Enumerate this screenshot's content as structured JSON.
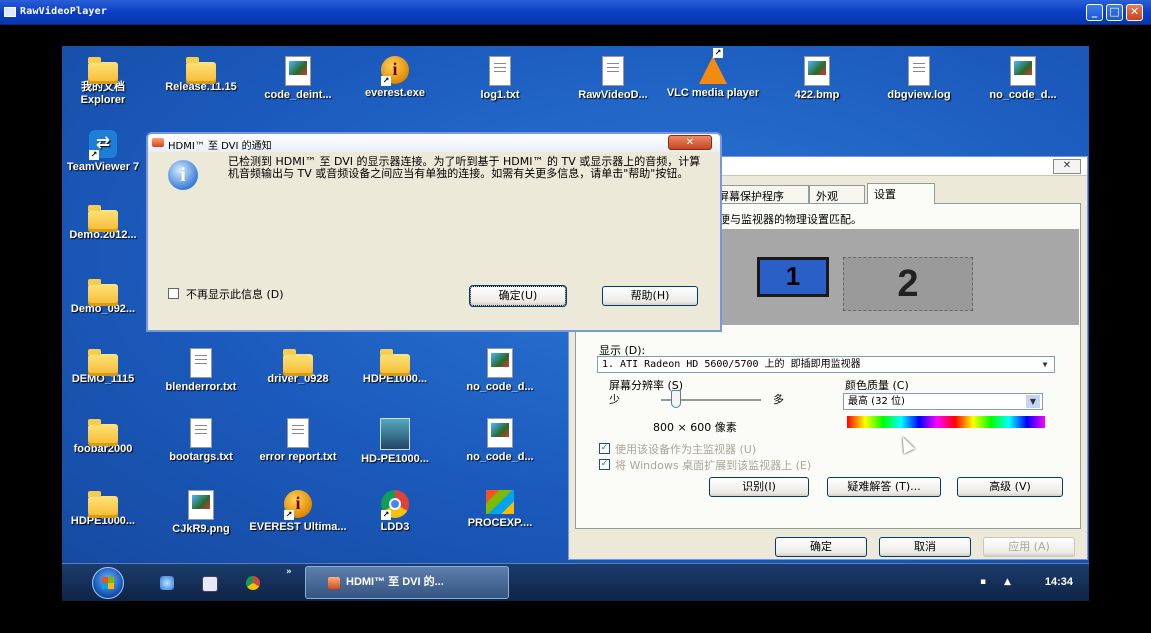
{
  "window": {
    "title": "RawVideoPlayer",
    "min": "_",
    "max": "□",
    "close": "✕"
  },
  "desktop_icons": [
    {
      "label": "我的文档\nExplorer",
      "icon": "folder-doc-icon",
      "x": 0,
      "y": 10
    },
    {
      "label": "Release.11.15",
      "icon": "folder-icon",
      "x": 1,
      "y": 10
    },
    {
      "label": "code_deint...",
      "icon": "image-file-icon",
      "x": 2,
      "y": 10
    },
    {
      "label": "everest.exe",
      "icon": "everest-icon",
      "x": 3,
      "y": 10
    },
    {
      "label": "log1.txt",
      "icon": "text-file-icon",
      "x": 4,
      "y": 10
    },
    {
      "label": "RawVideoD...",
      "icon": "text-file-icon",
      "x": 5,
      "y": 10
    },
    {
      "label": "VLC media player",
      "icon": "vlc-icon",
      "x": 6,
      "y": 10
    },
    {
      "label": "422.bmp",
      "icon": "image-file-icon",
      "x": 7,
      "y": 10
    },
    {
      "label": "dbgview.log",
      "icon": "text-file-icon",
      "x": 8,
      "y": 10
    },
    {
      "label": "no_code_d...",
      "icon": "image-file-icon",
      "x": 9,
      "y": 10
    }
  ],
  "col0_icons": [
    {
      "label": "TeamViewer 7",
      "icon": "teamviewer-icon"
    },
    {
      "label": "Demo.2012...",
      "icon": "folder-icon"
    },
    {
      "label": "Demo_092...",
      "icon": "folder-icon"
    }
  ],
  "row4_icons": [
    {
      "label": "DEMO_1115",
      "icon": "folder-icon"
    },
    {
      "label": "blenderror.txt",
      "icon": "text-file-icon"
    },
    {
      "label": "driver_0928",
      "icon": "folder-icon"
    },
    {
      "label": "HDPE1000...",
      "icon": "folder-icon"
    },
    {
      "label": "no_code_d...",
      "icon": "image-file-icon"
    }
  ],
  "row5_icons": [
    {
      "label": "foobar2000",
      "icon": "folder-icon"
    },
    {
      "label": "bootargs.txt",
      "icon": "text-file-icon"
    },
    {
      "label": "error report.txt",
      "icon": "text-file-icon"
    },
    {
      "label": "HD-PE1000...",
      "icon": "setup-icon"
    },
    {
      "label": "no_code_d...",
      "icon": "image-file-icon"
    }
  ],
  "row6_icons": [
    {
      "label": "HDPE1000...",
      "icon": "folder-icon"
    },
    {
      "label": "CJkR9.png",
      "icon": "image-file-icon"
    },
    {
      "label": "EVEREST Ultima...",
      "icon": "everest-icon"
    },
    {
      "label": "LDD3",
      "icon": "chrome-icon"
    },
    {
      "label": "PROCEXP....",
      "icon": "procexp-icon"
    }
  ],
  "display_dialog": {
    "close": "✕",
    "tabs": [
      "屏幕保护程序",
      "外观",
      "设置"
    ],
    "hint": "便与监视器的物理设置匹配。",
    "monitor1": "1",
    "monitor2": "2",
    "display_label": "显示 (D):",
    "display_value": "1. ATI Radeon HD 5600/5700 上的 即插即用监视器",
    "resolution_label": "屏幕分辨率 (S)",
    "less": "少",
    "more": "多",
    "resolution_value": "800 × 600 像素",
    "color_label": "颜色质量 (C)",
    "color_value": "最高 (32 位)",
    "chk_primary": "使用该设备作为主监视器 (U)",
    "chk_extend": "将 Windows 桌面扩展到该监视器上 (E)",
    "btn_identify": "识别(I)",
    "btn_troubleshoot": "疑难解答 (T)...",
    "btn_advanced": "高级 (V)",
    "btn_ok": "确定",
    "btn_cancel": "取消",
    "btn_apply": "应用 (A)"
  },
  "notify_dialog": {
    "title": "HDMI™ 至 DVI 的通知",
    "close": "✕",
    "message": "已检测到 HDMI™ 至 DVI 的显示器连接。为了听到基于 HDMI™ 的 TV 或显示器上的音频，计算机音频输出与 TV 或音频设备之间应当有单独的连接。如需有关更多信息，请单击\"帮助\"按钮。",
    "dont_show": "不再显示此信息 (D)",
    "ok": "确定(U)",
    "help": "帮助(H)"
  },
  "taskbar": {
    "task_label": "HDMI™ 至 DVI 的...",
    "chevron": "»",
    "clock": "14:34"
  }
}
